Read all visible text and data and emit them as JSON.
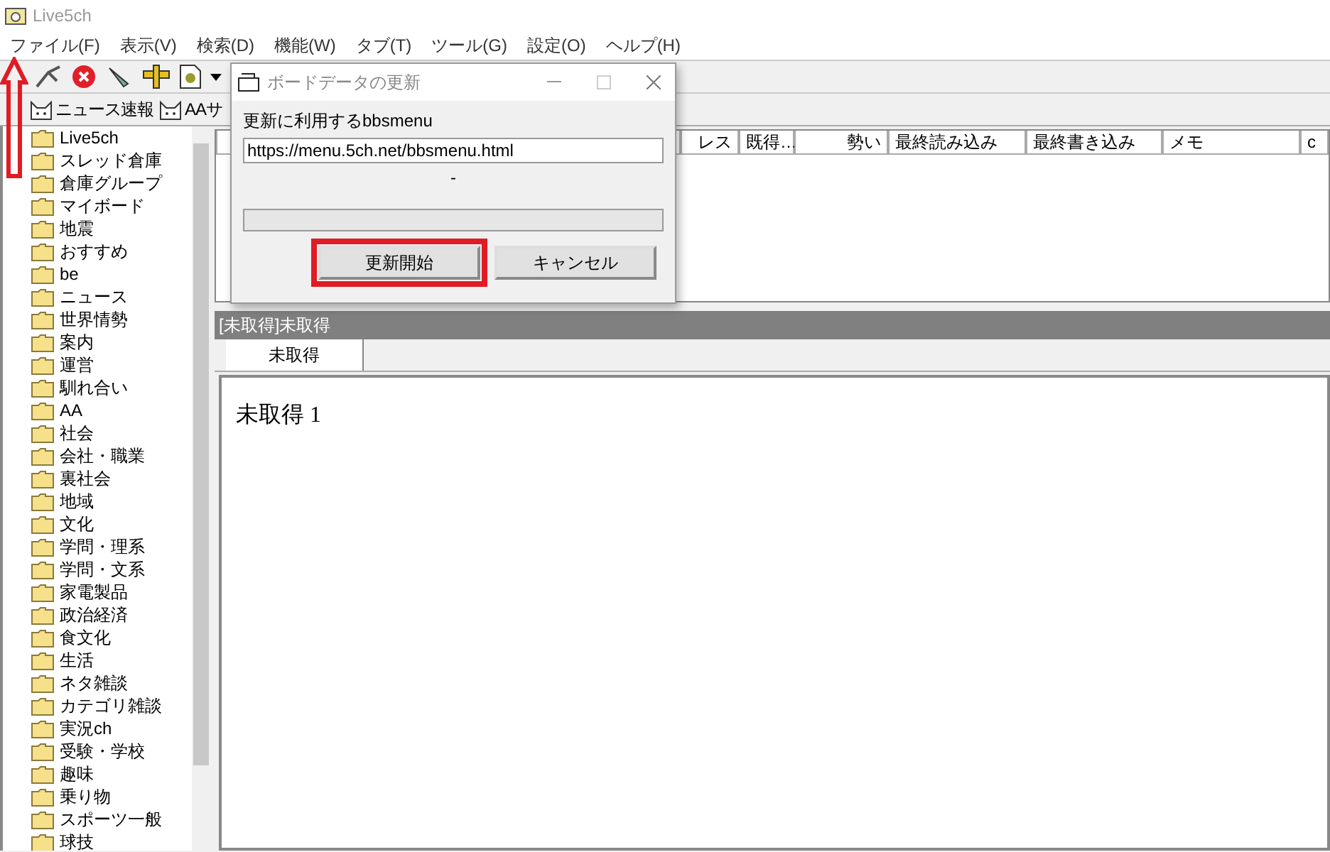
{
  "window": {
    "title": "Live5ch"
  },
  "menu": [
    "ファイル(F)",
    "表示(V)",
    "検索(D)",
    "機能(W)",
    "タブ(T)",
    "ツール(G)",
    "設定(O)",
    "ヘルプ(H)"
  ],
  "link_bar": [
    "ニュース速報",
    "AAサ"
  ],
  "sidebar": {
    "items": [
      "Live5ch",
      "スレッド倉庫",
      "倉庫グループ",
      "マイボード",
      "地震",
      "おすすめ",
      "be",
      "ニュース",
      "世界情勢",
      "案内",
      "運営",
      "馴れ合い",
      "AA",
      "社会",
      "会社・職業",
      "裏社会",
      "地域",
      "文化",
      "学問・理系",
      "学問・文系",
      "家電製品",
      "政治経済",
      "食文化",
      "生活",
      "ネタ雑談",
      "カテゴリ雑談",
      "実況ch",
      "受験・学校",
      "趣味",
      "乗り物",
      "スポーツ一般",
      "球技"
    ]
  },
  "thread_list": {
    "columns": [
      "レス",
      "既得…",
      "勢い",
      "最終読み込み",
      "最終書き込み",
      "メモ",
      "c"
    ]
  },
  "board_title": "[未取得]未取得",
  "tabs": [
    {
      "label": "未取得",
      "selected": true
    }
  ],
  "content": "未取得 1",
  "dialog": {
    "title": "ボードデータの更新",
    "label": "更新に利用するbbsmenu",
    "url": "https://menu.5ch.net/bbsmenu.html",
    "status": "-",
    "progress": {
      "level": 0
    },
    "buttons": [
      {
        "label": "更新開始",
        "highlighted": true
      },
      {
        "label": "キャンセル",
        "highlighted": false
      }
    ]
  }
}
